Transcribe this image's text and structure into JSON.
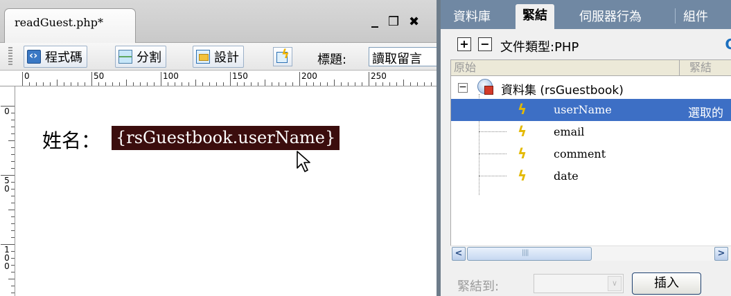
{
  "document_window": {
    "tab_title": "readGuest.php*",
    "minimize_symbol": "_",
    "restore_symbol": "❒",
    "close_symbol": "✖"
  },
  "toolbar": {
    "code_label": "程式碼",
    "split_label": "分割",
    "design_label": "設計",
    "title_label": "標題:",
    "title_value": "讀取留言"
  },
  "ruler": {
    "horizontal_marks": [
      "0",
      "50",
      "100",
      "150",
      "200",
      "250"
    ],
    "vertical_marks": [
      "0",
      "50",
      "100"
    ]
  },
  "design_view": {
    "field_label": "姓名：",
    "binding_text": "{rsGuestbook.userName}"
  },
  "panel": {
    "tabs": [
      "資料庫",
      "緊結",
      "伺服器行為",
      "組件"
    ],
    "active_tab": "緊結",
    "doc_type_label": "文件類型:PHP",
    "columns": [
      "原始",
      "緊結"
    ],
    "dataset_label": "資料集 (rsGuestbook)",
    "fields": [
      {
        "name": "userName",
        "binding": "選取的",
        "selected": true
      },
      {
        "name": "email",
        "binding": "",
        "selected": false
      },
      {
        "name": "comment",
        "binding": "",
        "selected": false
      },
      {
        "name": "date",
        "binding": "",
        "selected": false
      }
    ],
    "bind_to_label": "緊結到:",
    "insert_label": "插入"
  },
  "colors": {
    "selection": "#3d6fc5",
    "panel_tabbar": "#7088a3",
    "binding_highlight": "#3b0d0d"
  }
}
